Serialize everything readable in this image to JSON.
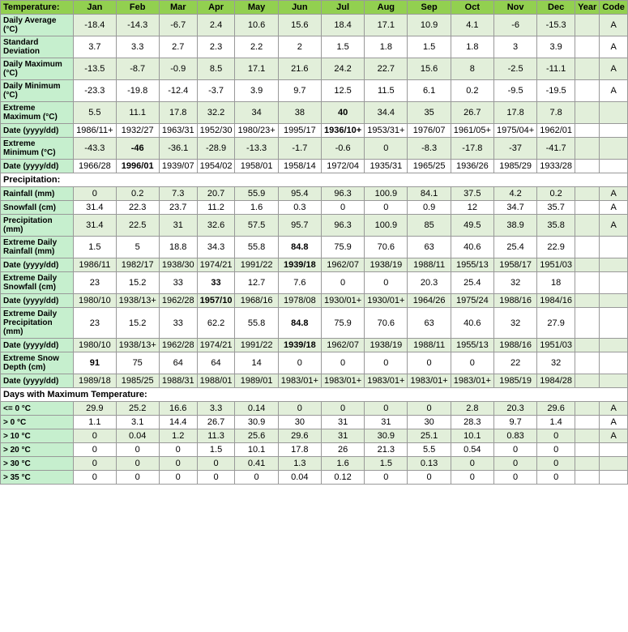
{
  "headers": {
    "temperature": "Temperature:",
    "precipitation": "Precipitation:",
    "days": "Days with Maximum Temperature:",
    "columns": [
      "Jan",
      "Feb",
      "Mar",
      "Apr",
      "May",
      "Jun",
      "Jul",
      "Aug",
      "Sep",
      "Oct",
      "Nov",
      "Dec",
      "Year",
      "Code"
    ]
  },
  "rows": {
    "temp": [
      {
        "label": "Daily Average (°C)",
        "values": [
          "-18.4",
          "-14.3",
          "-6.7",
          "2.4",
          "10.6",
          "15.6",
          "18.4",
          "17.1",
          "10.9",
          "4.1",
          "-6",
          "-15.3",
          "",
          "A"
        ],
        "style": "green"
      },
      {
        "label": "Standard Deviation",
        "values": [
          "3.7",
          "3.3",
          "2.7",
          "2.3",
          "2.2",
          "2",
          "1.5",
          "1.8",
          "1.5",
          "1.8",
          "3",
          "3.9",
          "",
          "A"
        ],
        "style": "white"
      },
      {
        "label": "Daily Maximum (°C)",
        "values": [
          "-13.5",
          "-8.7",
          "-0.9",
          "8.5",
          "17.1",
          "21.6",
          "24.2",
          "22.7",
          "15.6",
          "8",
          "-2.5",
          "-11.1",
          "",
          "A"
        ],
        "style": "green"
      },
      {
        "label": "Daily Minimum (°C)",
        "values": [
          "-23.3",
          "-19.8",
          "-12.4",
          "-3.7",
          "3.9",
          "9.7",
          "12.5",
          "11.5",
          "6.1",
          "0.2",
          "-9.5",
          "-19.5",
          "",
          "A"
        ],
        "style": "white"
      },
      {
        "label": "Extreme Maximum (°C)",
        "values": [
          "5.5",
          "11.1",
          "17.8",
          "32.2",
          "34",
          "38",
          "40",
          "34.4",
          "35",
          "26.7",
          "17.8",
          "7.8",
          "",
          ""
        ],
        "style": "green",
        "bold": [
          6
        ]
      },
      {
        "label": "Date (yyyy/dd)",
        "values": [
          "1986/11+",
          "1932/27",
          "1963/31",
          "1952/30",
          "1980/23+",
          "1995/17",
          "1936/10+",
          "1953/31+",
          "1976/07",
          "1961/05+",
          "1975/04+",
          "1962/01",
          "",
          ""
        ],
        "style": "white",
        "bold": [
          6
        ]
      },
      {
        "label": "Extreme Minimum (°C)",
        "values": [
          "-43.3",
          "-46",
          "-36.1",
          "-28.9",
          "-13.3",
          "-1.7",
          "-0.6",
          "0",
          "-8.3",
          "-17.8",
          "-37",
          "-41.7",
          "",
          ""
        ],
        "style": "green",
        "bold": [
          1
        ]
      },
      {
        "label": "Date (yyyy/dd)",
        "values": [
          "1966/28",
          "1996/01",
          "1939/07",
          "1954/02",
          "1958/01",
          "1958/14",
          "1972/04",
          "1935/31",
          "1965/25",
          "1936/26",
          "1985/29",
          "1933/28",
          "",
          ""
        ],
        "style": "white",
        "bold": [
          1
        ]
      }
    ],
    "precip": [
      {
        "label": "Rainfall (mm)",
        "values": [
          "0",
          "0.2",
          "7.3",
          "20.7",
          "55.9",
          "95.4",
          "96.3",
          "100.9",
          "84.1",
          "37.5",
          "4.2",
          "0.2",
          "",
          "A"
        ],
        "style": "green"
      },
      {
        "label": "Snowfall (cm)",
        "values": [
          "31.4",
          "22.3",
          "23.7",
          "11.2",
          "1.6",
          "0.3",
          "0",
          "0",
          "0.9",
          "12",
          "34.7",
          "35.7",
          "",
          "A"
        ],
        "style": "white"
      },
      {
        "label": "Precipitation (mm)",
        "values": [
          "31.4",
          "22.5",
          "31",
          "32.6",
          "57.5",
          "95.7",
          "96.3",
          "100.9",
          "85",
          "49.5",
          "38.9",
          "35.8",
          "",
          "A"
        ],
        "style": "green"
      },
      {
        "label": "Extreme Daily Rainfall (mm)",
        "values": [
          "1.5",
          "5",
          "18.8",
          "34.3",
          "55.8",
          "84.8",
          "75.9",
          "70.6",
          "63",
          "40.6",
          "25.4",
          "22.9",
          "",
          ""
        ],
        "style": "white",
        "bold": [
          5
        ]
      },
      {
        "label": "Date (yyyy/dd)",
        "values": [
          "1986/11",
          "1982/17",
          "1938/30",
          "1974/21",
          "1991/22",
          "1939/18",
          "1962/07",
          "1938/19",
          "1988/11",
          "1955/13",
          "1958/17",
          "1951/03",
          "",
          ""
        ],
        "style": "green",
        "bold": [
          5
        ]
      },
      {
        "label": "Extreme Daily Snowfall (cm)",
        "values": [
          "23",
          "15.2",
          "33",
          "33",
          "12.7",
          "7.6",
          "0",
          "0",
          "20.3",
          "25.4",
          "32",
          "18",
          "",
          ""
        ],
        "style": "white",
        "bold": [
          3
        ]
      },
      {
        "label": "Date (yyyy/dd)",
        "values": [
          "1980/10",
          "1938/13+",
          "1962/28",
          "1957/10",
          "1968/16",
          "1978/08",
          "1930/01+",
          "1930/01+",
          "1964/26",
          "1975/24",
          "1988/16",
          "1984/16",
          "",
          ""
        ],
        "style": "green",
        "bold": [
          3
        ]
      },
      {
        "label": "Extreme Daily Precipitation (mm)",
        "values": [
          "23",
          "15.2",
          "33",
          "62.2",
          "55.8",
          "84.8",
          "75.9",
          "70.6",
          "63",
          "40.6",
          "32",
          "27.9",
          "",
          ""
        ],
        "style": "white",
        "bold": [
          5
        ]
      },
      {
        "label": "Date (yyyy/dd)",
        "values": [
          "1980/10",
          "1938/13+",
          "1962/28",
          "1974/21",
          "1991/22",
          "1939/18",
          "1962/07",
          "1938/19",
          "1988/11",
          "1955/13",
          "1988/16",
          "1951/03",
          "",
          ""
        ],
        "style": "green",
        "bold": [
          5
        ]
      },
      {
        "label": "Extreme Snow Depth (cm)",
        "values": [
          "91",
          "75",
          "64",
          "64",
          "14",
          "0",
          "0",
          "0",
          "0",
          "0",
          "22",
          "32",
          "",
          ""
        ],
        "style": "white",
        "bold": [
          0
        ]
      },
      {
        "label": "Date (yyyy/dd)",
        "values": [
          "1989/18",
          "1985/25",
          "1988/31",
          "1988/01",
          "1989/01",
          "1983/01+",
          "1983/01+",
          "1983/01+",
          "1983/01+",
          "1983/01+",
          "1985/19",
          "1984/28",
          "",
          ""
        ],
        "style": "green"
      }
    ],
    "days": [
      {
        "label": "<= 0 °C",
        "values": [
          "29.9",
          "25.2",
          "16.6",
          "3.3",
          "0.14",
          "0",
          "0",
          "0",
          "0",
          "2.8",
          "20.3",
          "29.6",
          "",
          "A"
        ],
        "style": "green"
      },
      {
        "label": "> 0 °C",
        "values": [
          "1.1",
          "3.1",
          "14.4",
          "26.7",
          "30.9",
          "30",
          "31",
          "31",
          "30",
          "28.3",
          "9.7",
          "1.4",
          "",
          "A"
        ],
        "style": "white"
      },
      {
        "label": "> 10 °C",
        "values": [
          "0",
          "0.04",
          "1.2",
          "11.3",
          "25.6",
          "29.6",
          "31",
          "30.9",
          "25.1",
          "10.1",
          "0.83",
          "0",
          "",
          "A"
        ],
        "style": "green"
      },
      {
        "label": "> 20 °C",
        "values": [
          "0",
          "0",
          "0",
          "1.5",
          "10.1",
          "17.8",
          "26",
          "21.3",
          "5.5",
          "0.54",
          "0",
          "0",
          "",
          ""
        ],
        "style": "white"
      },
      {
        "label": "> 30 °C",
        "values": [
          "0",
          "0",
          "0",
          "0",
          "0.41",
          "1.3",
          "1.6",
          "1.5",
          "0.13",
          "0",
          "0",
          "0",
          "",
          ""
        ],
        "style": "green"
      },
      {
        "label": "> 35 °C",
        "values": [
          "0",
          "0",
          "0",
          "0",
          "0",
          "0.04",
          "0.12",
          "0",
          "0",
          "0",
          "0",
          "0",
          "",
          ""
        ],
        "style": "white"
      }
    ]
  }
}
